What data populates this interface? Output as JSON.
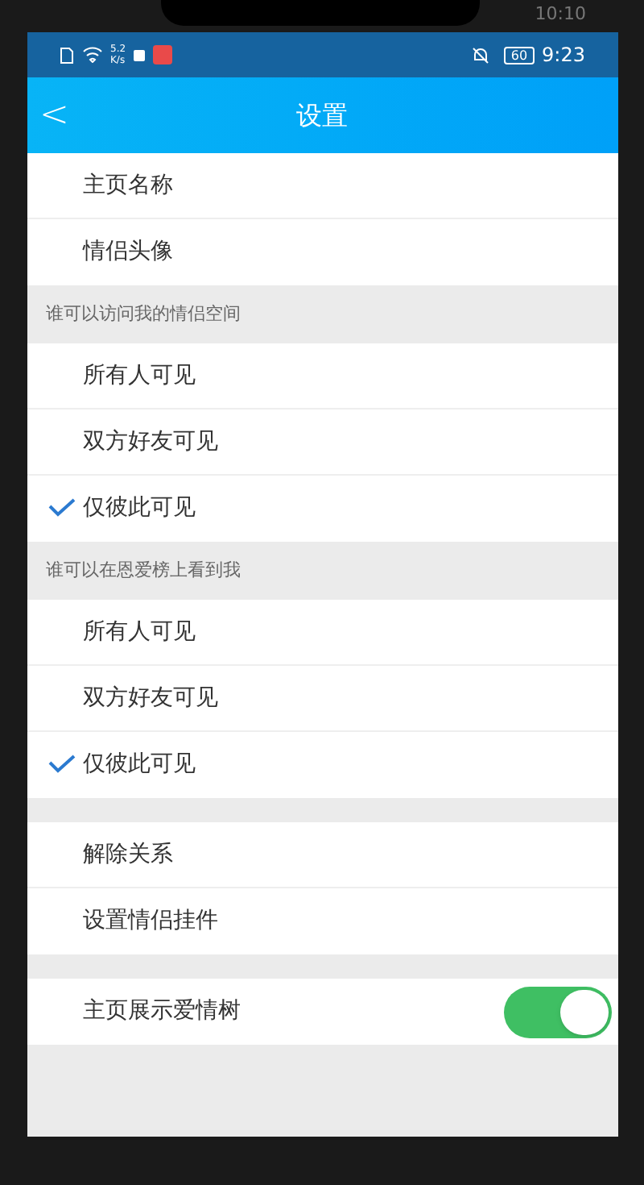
{
  "device_status": {
    "time": "10:10"
  },
  "status_bar": {
    "speed": "5.2",
    "speed_unit": "K/s",
    "battery": "60",
    "time": "9:23"
  },
  "header": {
    "title": "设置",
    "back": "<"
  },
  "groups": [
    {
      "items": [
        {
          "kind": "link",
          "label": "主页名称"
        },
        {
          "kind": "link",
          "label": "情侣头像"
        }
      ]
    },
    {
      "title": "谁可以访问我的情侣空间",
      "items": [
        {
          "kind": "option",
          "label": "所有人可见",
          "selected": false
        },
        {
          "kind": "option",
          "label": "双方好友可见",
          "selected": false
        },
        {
          "kind": "option",
          "label": "仅彼此可见",
          "selected": true
        }
      ]
    },
    {
      "title": "谁可以在恩爱榜上看到我",
      "items": [
        {
          "kind": "option",
          "label": "所有人可见",
          "selected": false
        },
        {
          "kind": "option",
          "label": "双方好友可见",
          "selected": false
        },
        {
          "kind": "option",
          "label": "仅彼此可见",
          "selected": true
        }
      ]
    },
    {
      "items": [
        {
          "kind": "link",
          "label": "解除关系"
        },
        {
          "kind": "link",
          "label": "设置情侣挂件"
        }
      ]
    },
    {
      "items": [
        {
          "kind": "toggle",
          "label": "主页展示爱情树",
          "on": true
        }
      ]
    }
  ]
}
